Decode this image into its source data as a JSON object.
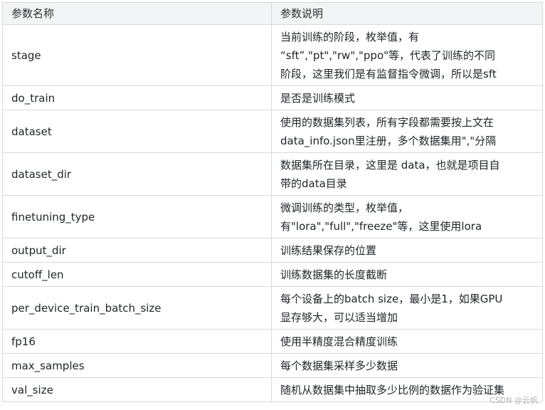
{
  "table": {
    "headers": [
      "参数名称",
      "参数说明"
    ],
    "rows": [
      {
        "name": "stage",
        "desc": "当前训练的阶段，枚举值，有\n“sft”,\"pt\",\"rw\",\"ppo\"等，代表了训练的不同\n阶段，这里我们是有监督指令微调，所以是sft"
      },
      {
        "name": "do_train",
        "desc": "是否是训练模式"
      },
      {
        "name": "dataset",
        "desc": "使用的数据集列表，所有字段都需要按上文在\ndata_info.json里注册，多个数据集用\",\"分隔"
      },
      {
        "name": "dataset_dir",
        "desc": "数据集所在目录，这里是 data，也就是项目自\n带的data目录"
      },
      {
        "name": "finetuning_type",
        "desc": "微调训练的类型，枚举值，\n有\"lora\",\"full\",\"freeze\"等，这里使用lora"
      },
      {
        "name": "output_dir",
        "desc": "训练结果保存的位置"
      },
      {
        "name": "cutoff_len",
        "desc": "训练数据集的长度截断"
      },
      {
        "name": "per_device_train_batch_size",
        "desc": "每个设备上的batch size，最小是1，如果GPU\n显存够大，可以适当增加"
      },
      {
        "name": "fp16",
        "desc": "使用半精度混合精度训练"
      },
      {
        "name": "max_samples",
        "desc": "每个数据集采样多少数据"
      },
      {
        "name": "val_size",
        "desc": "随机从数据集中抽取多少比例的数据作为验证集"
      }
    ]
  },
  "watermark": "CSDN @云帆"
}
